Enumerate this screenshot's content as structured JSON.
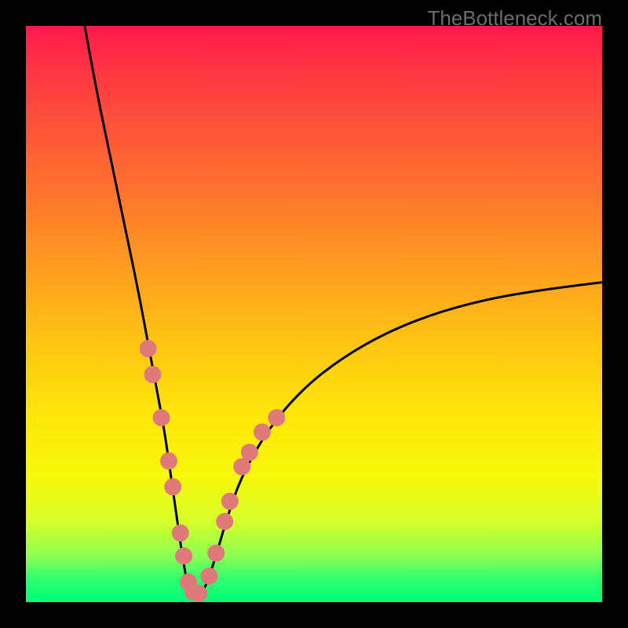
{
  "attribution": "TheBottleneck.com",
  "chart_data": {
    "type": "line",
    "title": "",
    "xlabel": "",
    "ylabel": "",
    "xlim": [
      0,
      100
    ],
    "ylim": [
      0,
      100
    ],
    "curve": {
      "description": "V-shaped bottleneck curve with minimum near x≈28, left arm falling from (10,100) to trough, right arm rising asymptotically toward ~55 at x=100",
      "path": [
        [
          10.2,
          100.0
        ],
        [
          12.0,
          90.0
        ],
        [
          14.5,
          78.0
        ],
        [
          17.0,
          66.0
        ],
        [
          19.5,
          54.0
        ],
        [
          21.0,
          46.0
        ],
        [
          22.5,
          38.0
        ],
        [
          24.0,
          30.0
        ],
        [
          25.0,
          23.0
        ],
        [
          26.0,
          16.0
        ],
        [
          27.0,
          9.0
        ],
        [
          28.0,
          3.0
        ],
        [
          29.5,
          1.0
        ],
        [
          31.0,
          2.0
        ],
        [
          33.0,
          8.0
        ],
        [
          35.0,
          15.0
        ],
        [
          37.5,
          22.0
        ],
        [
          42.0,
          30.0
        ],
        [
          48.0,
          37.0
        ],
        [
          55.0,
          42.5
        ],
        [
          63.0,
          47.0
        ],
        [
          72.0,
          50.5
        ],
        [
          82.0,
          53.0
        ],
        [
          92.0,
          54.5
        ],
        [
          100.0,
          55.5
        ]
      ]
    },
    "series": [
      {
        "name": "highlighted-points",
        "color": "#e07a7a",
        "points": [
          [
            21.2,
            44.0
          ],
          [
            22.0,
            39.5
          ],
          [
            23.5,
            32.0
          ],
          [
            24.8,
            24.5
          ],
          [
            25.5,
            20.0
          ],
          [
            26.8,
            12.0
          ],
          [
            27.4,
            8.0
          ],
          [
            28.2,
            3.5
          ],
          [
            29.0,
            1.8
          ],
          [
            30.0,
            1.5
          ],
          [
            31.8,
            4.5
          ],
          [
            33.0,
            8.5
          ],
          [
            34.5,
            14.0
          ],
          [
            35.4,
            17.5
          ],
          [
            37.5,
            23.5
          ],
          [
            38.8,
            26.0
          ],
          [
            41.0,
            29.5
          ],
          [
            43.5,
            32.0
          ]
        ]
      }
    ]
  }
}
